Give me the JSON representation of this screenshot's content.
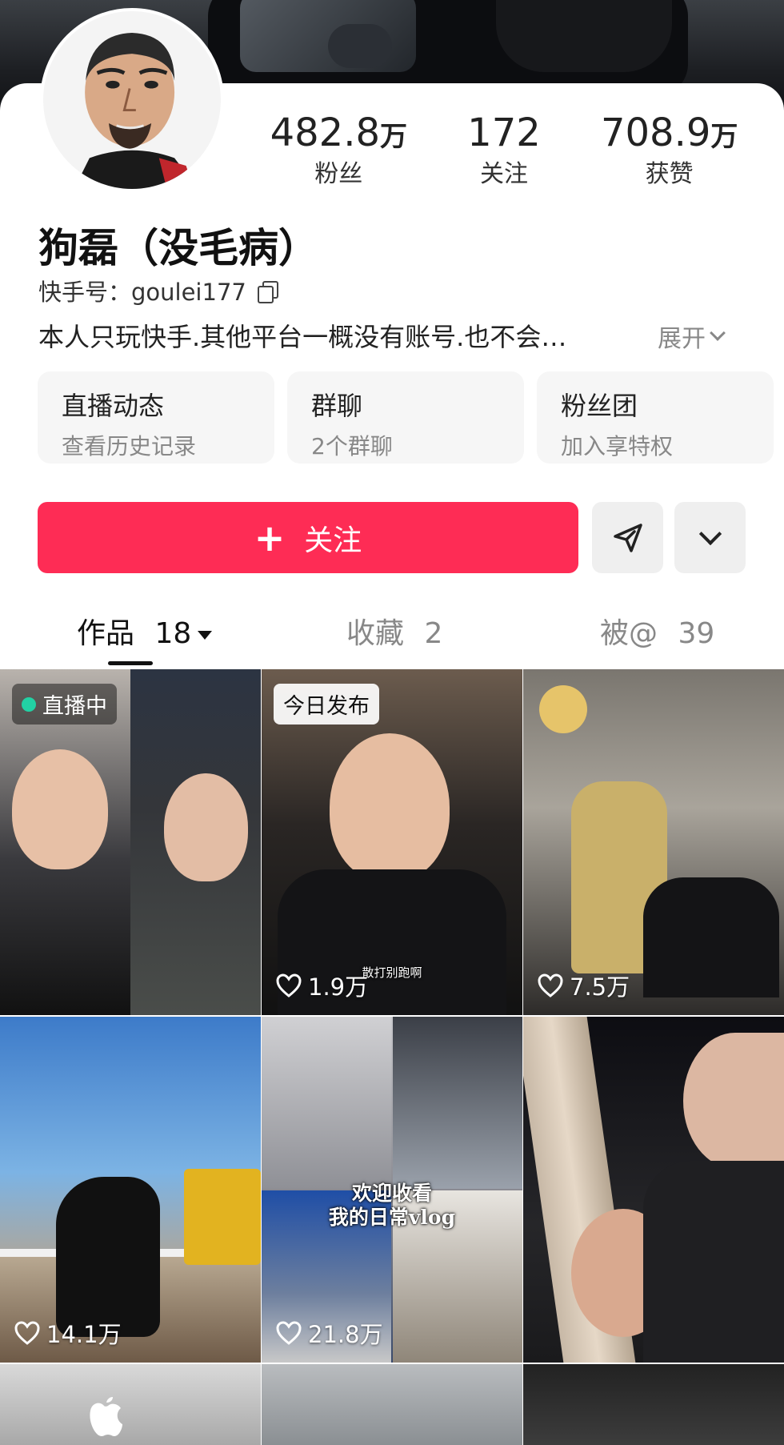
{
  "profile": {
    "name": "狗磊（没毛病）",
    "kuaishou_id": "快手号：goulei177",
    "bio": "本人只玩快手.其他平台一概没有账号.也不会…",
    "expand_label": "展开"
  },
  "stats": [
    {
      "value": "482.8",
      "unit": "万",
      "label": "粉丝"
    },
    {
      "value": "172",
      "unit": "",
      "label": "关注"
    },
    {
      "value": "708.9",
      "unit": "万",
      "label": "获赞"
    }
  ],
  "cards": [
    {
      "title": "直播动态",
      "subtitle": "查看历史记录"
    },
    {
      "title": "群聊",
      "subtitle": "2个群聊"
    },
    {
      "title": "粉丝团",
      "subtitle": "加入享特权"
    }
  ],
  "actions": {
    "follow_label": "关注",
    "share_icon": "paper-plane-icon",
    "more_icon": "chevron-down-icon"
  },
  "tabs": [
    {
      "label": "作品",
      "count": "18"
    },
    {
      "label": "收藏",
      "count": "2"
    },
    {
      "label": "被@",
      "count": "39"
    }
  ],
  "videos": [
    {
      "badge": "直播中",
      "likes": "",
      "caption": ""
    },
    {
      "badge": "今日发布",
      "likes": "1.9万",
      "caption": "散打别跑啊"
    },
    {
      "badge": "",
      "likes": "7.5万",
      "caption": ""
    },
    {
      "badge": "",
      "likes": "14.1万",
      "caption": ""
    },
    {
      "badge": "",
      "likes": "21.8万",
      "caption": "欢迎收看\n我的日常vlog"
    },
    {
      "badge": "",
      "likes": "",
      "caption": ""
    }
  ],
  "colors": {
    "follow_button": "#fe2c55",
    "live_dot": "#22d1a4"
  }
}
